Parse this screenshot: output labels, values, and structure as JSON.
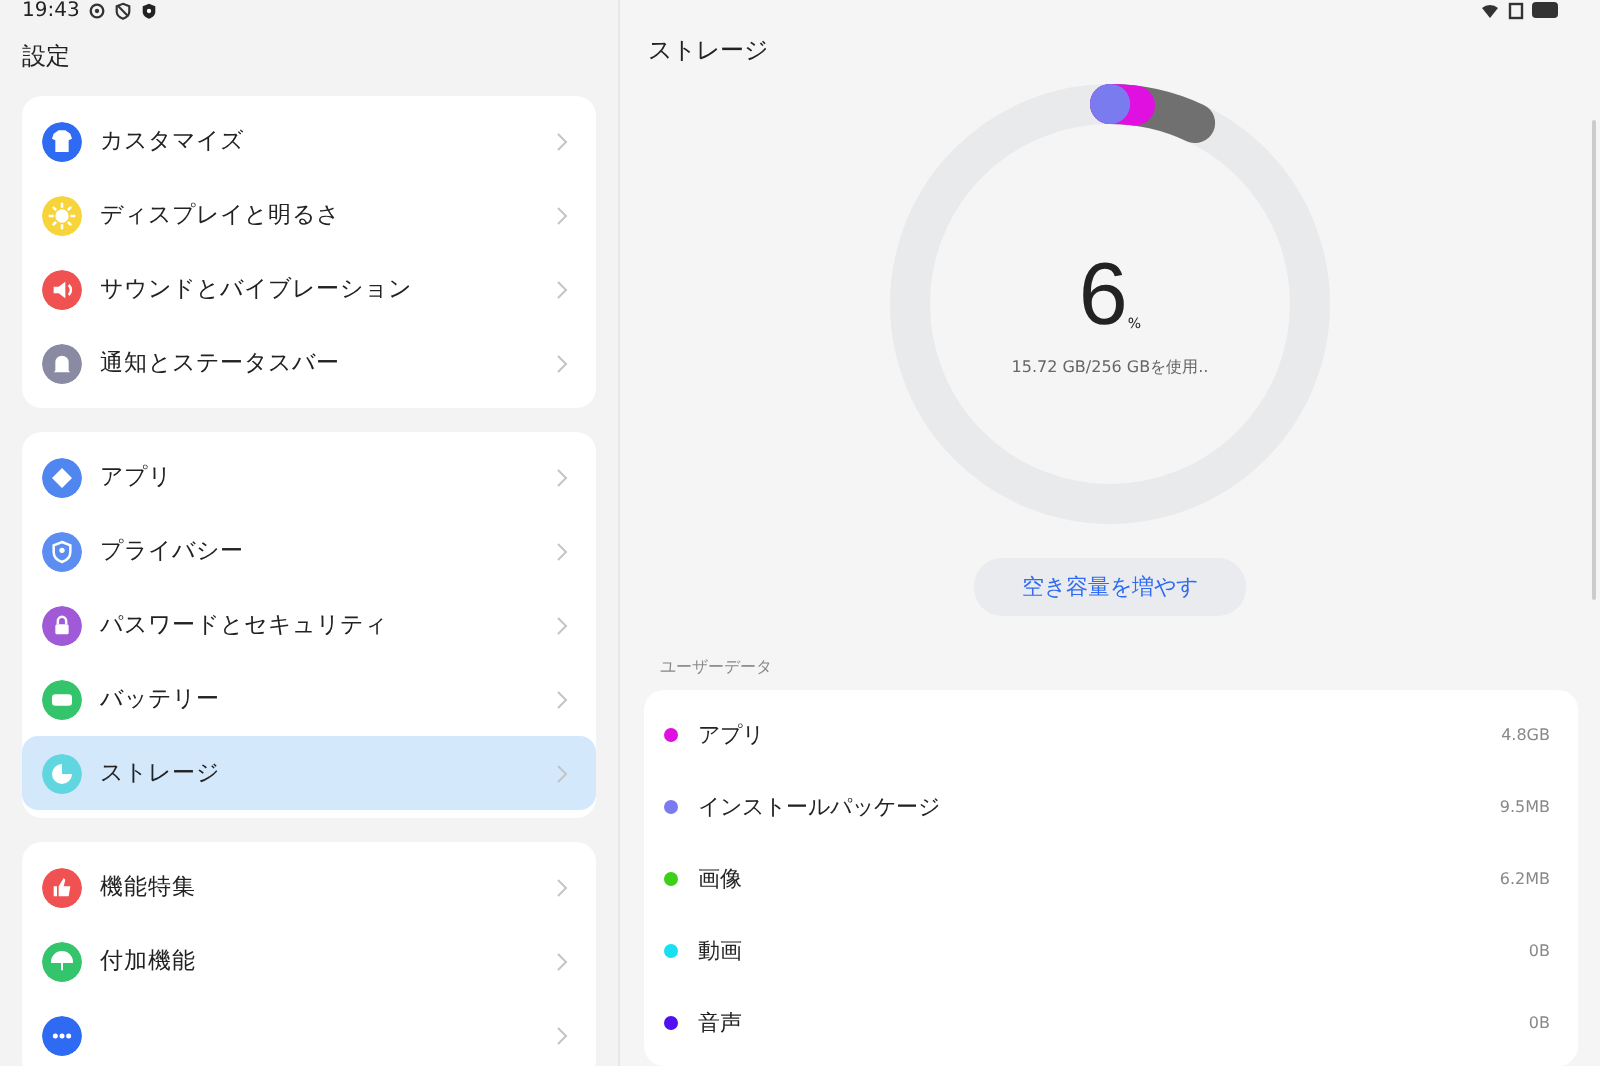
{
  "status_bar": {
    "time": "19:43"
  },
  "sidebar": {
    "title": "設定",
    "groups": [
      {
        "items": [
          {
            "label": "カスタマイズ",
            "color": "#2f6bf2",
            "selected": false
          },
          {
            "label": "ディスプレイと明るさ",
            "color": "#f7d43a",
            "selected": false
          },
          {
            "label": "サウンドとバイブレーション",
            "color": "#f05252",
            "selected": false
          },
          {
            "label": "通知とステータスバー",
            "color": "#8a8aa3",
            "selected": false
          }
        ]
      },
      {
        "items": [
          {
            "label": "アプリ",
            "color": "#4f86f0",
            "selected": false
          },
          {
            "label": "プライバシー",
            "color": "#5b8ef0",
            "selected": false
          },
          {
            "label": "パスワードとセキュリティ",
            "color": "#a05ad8",
            "selected": false
          },
          {
            "label": "バッテリー",
            "color": "#34c46c",
            "selected": false
          },
          {
            "label": "ストレージ",
            "color": "#5fd6e0",
            "selected": true
          }
        ]
      },
      {
        "items": [
          {
            "label": "機能特集",
            "color": "#f05252",
            "selected": false
          },
          {
            "label": "付加機能",
            "color": "#34c46c",
            "selected": false
          },
          {
            "color": "#2f6bf2",
            "selected": false
          }
        ]
      }
    ]
  },
  "detail": {
    "title": "ストレージ",
    "percent": "6",
    "percent_unit": "%",
    "usage": "15.72 GB/256 GBを使用..",
    "action_button": "空き容量を増やす",
    "section_label": "ユーザーデータ",
    "items": [
      {
        "name": "アプリ",
        "size": "4.8GB",
        "color": "#e010e0"
      },
      {
        "name": "インストールパッケージ",
        "size": "9.5MB",
        "color": "#7b7bf0"
      },
      {
        "name": "画像",
        "size": "6.2MB",
        "color": "#3cd018"
      },
      {
        "name": "動画",
        "size": "0B",
        "color": "#18e0f0"
      },
      {
        "name": "音声",
        "size": "0B",
        "color": "#5010f0"
      }
    ]
  }
}
